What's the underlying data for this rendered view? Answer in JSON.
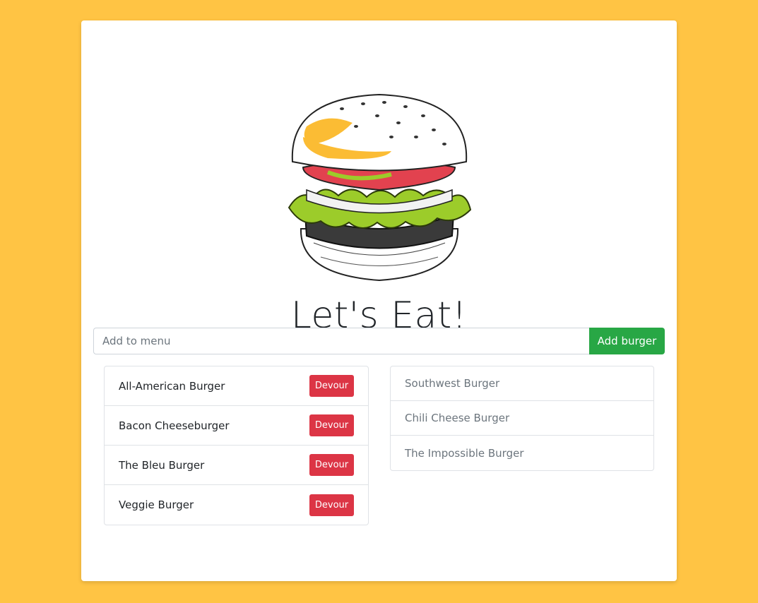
{
  "colors": {
    "background": "#ffc444",
    "add_button": "#28a745",
    "devour_button": "#dc3545"
  },
  "logo": {
    "icon": "burger-illustration"
  },
  "heading": "Let's Eat!",
  "add_form": {
    "placeholder": "Add to menu",
    "value": "",
    "button_label": "Add burger"
  },
  "menu": {
    "items": [
      {
        "name": "All-American Burger",
        "action": "Devour"
      },
      {
        "name": "Bacon Cheeseburger",
        "action": "Devour"
      },
      {
        "name": "The Bleu Burger",
        "action": "Devour"
      },
      {
        "name": "Veggie Burger",
        "action": "Devour"
      }
    ]
  },
  "devoured": {
    "items": [
      {
        "name": "Southwest Burger"
      },
      {
        "name": "Chili Cheese Burger"
      },
      {
        "name": "The Impossible Burger"
      }
    ]
  }
}
